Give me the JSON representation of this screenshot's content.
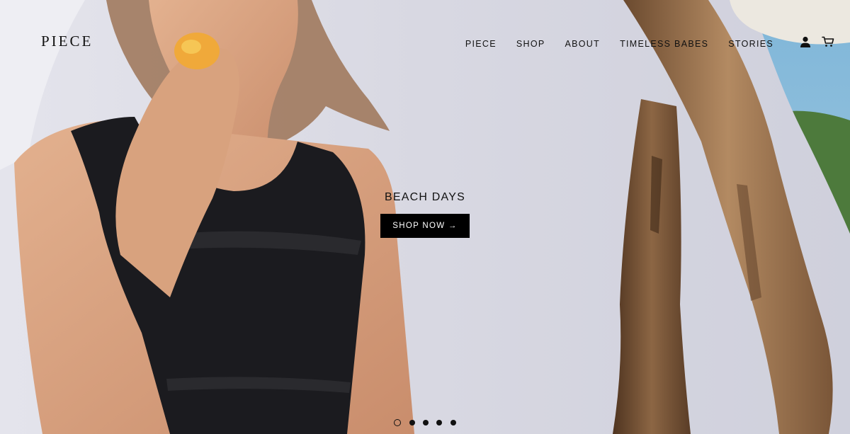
{
  "brand": {
    "logo_text": "PIECE"
  },
  "nav": {
    "items": [
      {
        "label": "PIECE"
      },
      {
        "label": "SHOP"
      },
      {
        "label": "ABOUT"
      },
      {
        "label": "TIMELESS BABES"
      },
      {
        "label": "STORIES"
      }
    ]
  },
  "header_icons": {
    "account": "user-icon",
    "cart": "cart-icon"
  },
  "slide": {
    "title": "BEACH DAYS",
    "cta_label": "SHOP NOW →"
  },
  "slider": {
    "total_slides": 5,
    "active_index": 0
  },
  "colors": {
    "text": "#111111",
    "button_bg": "#000000",
    "button_text": "#ffffff"
  }
}
